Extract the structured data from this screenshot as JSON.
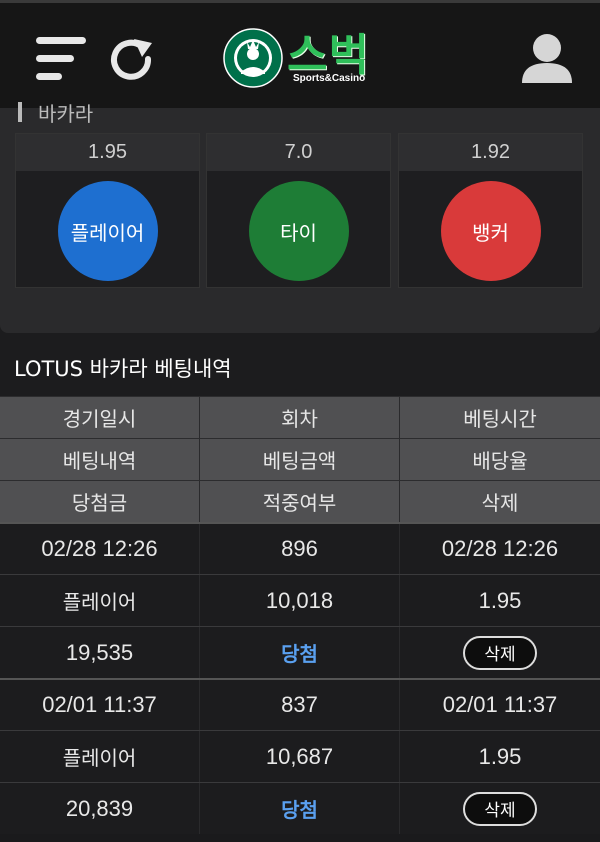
{
  "header": {
    "logo_text": "스벅",
    "logo_sub": "Sports&Casino",
    "icons": [
      "menu-icon",
      "refresh-icon",
      "starbucks-logo",
      "user-icon"
    ]
  },
  "upper": {
    "section_title": "바카라",
    "bets": [
      {
        "odds": "1.95",
        "label": "플레이어",
        "color": "#1e6fd0"
      },
      {
        "odds": "7.0",
        "label": "타이",
        "color": "#1e7d36"
      },
      {
        "odds": "1.92",
        "label": "뱅커",
        "color": "#d93a3a"
      }
    ]
  },
  "history": {
    "title": "LOTUS 바카라 베팅내역",
    "headers": [
      [
        "경기일시",
        "회차",
        "베팅시간"
      ],
      [
        "베팅내역",
        "베팅금액",
        "배당율"
      ],
      [
        "당첨금",
        "적중여부",
        "삭제"
      ]
    ],
    "records": [
      {
        "game_time": "02/28 12:26",
        "round": "896",
        "bet_time": "02/28 12:26",
        "bet_pick": "플레이어",
        "bet_amount": "10,018",
        "odds": "1.95",
        "payout": "19,535",
        "result": "당첨",
        "delete_label": "삭제"
      },
      {
        "game_time": "02/01 11:37",
        "round": "837",
        "bet_time": "02/01 11:37",
        "bet_pick": "플레이어",
        "bet_amount": "10,687",
        "odds": "1.95",
        "payout": "20,839",
        "result": "당첨",
        "delete_label": "삭제"
      }
    ]
  },
  "colors": {
    "win_text": "#5aa0f0",
    "logo_green": "#2fbf5a"
  }
}
